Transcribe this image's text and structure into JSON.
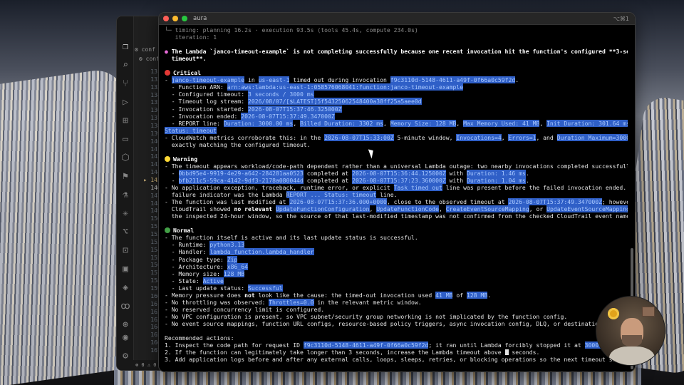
{
  "terminal": {
    "title": "aura",
    "shortcut": "⌥⌘1"
  },
  "editor": {
    "tabs": [
      "conf",
      "conf"
    ],
    "line_numbers": [
      "131",
      "132",
      "133",
      "134",
      "135",
      "136",
      "137",
      "138",
      "139",
      "140",
      "141",
      "142",
      "143",
      "144",
      "145",
      "146",
      "147",
      "148",
      "149",
      "150",
      "151",
      "152",
      "153",
      "154",
      "155",
      "156",
      "157",
      "158",
      "159",
      "160",
      "161",
      "162",
      "163",
      "164",
      "165",
      "166",
      "167"
    ],
    "current_line": "146",
    "marked_line": "145",
    "status": "⊗ 0 ⚠ 0"
  },
  "lines": {
    "l01": [
      {
        "t": "└─ timing: ",
        "c": "dim"
      },
      {
        "t": "planning 16.2s · execution 93.5s (tools 45.4s, compute 234.0s)",
        "c": "dim"
      }
    ],
    "l02": [
      {
        "t": "   iteration: 1",
        "c": "dim"
      }
    ],
    "l03": [
      {
        "t": ""
      }
    ],
    "l04": [
      {
        "t": "● ",
        "c": "pink"
      },
      {
        "t": "The Lambda `janco-timeout-example` is not completing successfully because one recent invocation hit the function's configured **3-second",
        "c": "b"
      }
    ],
    "l05": [
      {
        "t": "  timeout**.",
        "c": "b"
      }
    ],
    "l06": [
      {
        "t": ""
      }
    ],
    "l07": [
      {
        "t": "",
        "circle": "red"
      },
      {
        "t": "Critical",
        "c": "b"
      }
    ],
    "l08": [
      {
        "t": "- "
      },
      {
        "t": "janco-timeout-example",
        "c": "hl"
      },
      {
        "t": " in "
      },
      {
        "t": "us-east-1",
        "c": "hl"
      },
      {
        "t": " timed out during invocation "
      },
      {
        "t": "f9c3110d-5148-4611-a49f-0f66a0c59f2d",
        "c": "hl"
      },
      {
        "t": "."
      }
    ],
    "l09": [
      {
        "t": "  - Function ARN: "
      },
      {
        "t": "arn:aws:lambda:us-east-1:058576068041:function:janco-timeout-example",
        "c": "hl"
      }
    ],
    "l10": [
      {
        "t": "  - Configured timeout: "
      },
      {
        "t": "3 seconds / 3000 ms",
        "c": "hl"
      }
    ],
    "l11": [
      {
        "t": "  - Timeout log stream: "
      },
      {
        "t": "2026/08/07/[$LATEST]5f54325062548400a38ff25a5aee0d",
        "c": "hl"
      }
    ],
    "l12": [
      {
        "t": "  - Invocation started: "
      },
      {
        "t": "2026-08-07T15:37:46.325000Z",
        "c": "hl"
      }
    ],
    "l13": [
      {
        "t": "  - Invocation ended: "
      },
      {
        "t": "2026-08-07T15:37:49.347000Z",
        "c": "hl"
      }
    ],
    "l14": [
      {
        "t": "  - REPORT line: "
      },
      {
        "t": "Duration: 3000.00 ms",
        "c": "hl"
      },
      {
        "t": ", "
      },
      {
        "t": "Billed Duration: 3302 ms",
        "c": "hl"
      },
      {
        "t": ", "
      },
      {
        "t": "Memory Size: 128 MB",
        "c": "hl"
      },
      {
        "t": ", "
      },
      {
        "t": "Max Memory Used: 41 MB",
        "c": "hl"
      },
      {
        "t": ", "
      },
      {
        "t": "Init Duration: 301.64 ms",
        "c": "hl"
      },
      {
        "t": ","
      }
    ],
    "l15": [
      {
        "t": "Status: timeout",
        "c": "hl"
      }
    ],
    "l16": [
      {
        "t": "- CloudWatch metrics corroborate this: in the "
      },
      {
        "t": "2026-08-07T15:33:00Z",
        "c": "hl"
      },
      {
        "t": " 5-minute window, "
      },
      {
        "t": "Invocations=4",
        "c": "hl"
      },
      {
        "t": ", "
      },
      {
        "t": "Errors=1",
        "c": "hl"
      },
      {
        "t": ", and "
      },
      {
        "t": "Duration Maximum=3000.0 ms",
        "c": "hl"
      },
      {
        "t": ","
      }
    ],
    "l17": [
      {
        "t": "  exactly matching the configured timeout."
      }
    ],
    "l18": [
      {
        "t": ""
      }
    ],
    "l19": [
      {
        "t": "",
        "circle": "yel"
      },
      {
        "t": "Warning",
        "c": "b"
      }
    ],
    "l20": [
      {
        "t": "- The timeout appears workload/code-path dependent rather than a universal Lambda outage: two nearby invocations completed successfully."
      }
    ],
    "l21": [
      {
        "t": "  - "
      },
      {
        "t": "0bbd95e4-9919-4e29-a642-284281aa0523",
        "c": "hl"
      },
      {
        "t": " completed at "
      },
      {
        "t": "2026-08-07T15:36:44.125000Z",
        "c": "hl"
      },
      {
        "t": " with "
      },
      {
        "t": "Duration: 1.46 ms",
        "c": "hl"
      },
      {
        "t": "."
      }
    ],
    "l22": [
      {
        "t": "  - "
      },
      {
        "t": "bfb211c5-59ca-4142-9df3-2178a080044d",
        "c": "hl"
      },
      {
        "t": " completed at "
      },
      {
        "t": "2026-08-07T15:37:23.360000Z",
        "c": "hl"
      },
      {
        "t": " with "
      },
      {
        "t": "Duration: 1.04 ms",
        "c": "hl"
      },
      {
        "t": "."
      }
    ],
    "l23": [
      {
        "t": "- No application exception, traceback, runtime error, or explicit "
      },
      {
        "t": "Task timed out",
        "c": "hl"
      },
      {
        "t": " line was present before the failed invocation ended. The only"
      }
    ],
    "l24": [
      {
        "t": "  failure indicator was the Lambda "
      },
      {
        "t": "REPORT ... Status: timeout",
        "c": "hl"
      },
      {
        "t": " line."
      }
    ],
    "l25": [
      {
        "t": "- The function was last modified at "
      },
      {
        "t": "2026-08-07T15:37:36.000+0000",
        "c": "hl"
      },
      {
        "t": ", close to the observed timeout at "
      },
      {
        "t": "2026-08-07T15:37:49.347000Z",
        "c": "hl"
      },
      {
        "t": "; however,"
      }
    ],
    "l26": [
      {
        "t": "  CloudTrail showed "
      },
      {
        "t": "no relevant",
        "c": "b"
      },
      {
        "t": " "
      },
      {
        "t": "UpdateFunctionConfiguration",
        "c": "hl"
      },
      {
        "t": ", "
      },
      {
        "t": "UpdateFunctionCode",
        "c": "hl"
      },
      {
        "t": ", "
      },
      {
        "t": "CreateEventSourceMapping",
        "c": "hl"
      },
      {
        "t": ", or "
      },
      {
        "t": "UpdateEventSourceMapping",
        "c": "hl"
      },
      {
        "t": " events in"
      }
    ],
    "l27": [
      {
        "t": "  the inspected 24-hour window, so the source of that last-modified timestamp was not confirmed from the checked CloudTrail event names."
      }
    ],
    "l28": [
      {
        "t": ""
      }
    ],
    "l29": [
      {
        "t": "",
        "circle": "grn"
      },
      {
        "t": "Normal",
        "c": "b"
      }
    ],
    "l30": [
      {
        "t": "- The function itself is active and its last update status is successful."
      }
    ],
    "l31": [
      {
        "t": "  - Runtime: "
      },
      {
        "t": "python3.13",
        "c": "hl"
      }
    ],
    "l32": [
      {
        "t": "  - Handler: "
      },
      {
        "t": "lambda_function.lambda_handler",
        "c": "hl"
      }
    ],
    "l33": [
      {
        "t": "  - Package type: "
      },
      {
        "t": "Zip",
        "c": "hl"
      }
    ],
    "l34": [
      {
        "t": "  - Architecture: "
      },
      {
        "t": "x86_64",
        "c": "hl"
      }
    ],
    "l35": [
      {
        "t": "  - Memory size: "
      },
      {
        "t": "128 MB",
        "c": "hl"
      }
    ],
    "l36": [
      {
        "t": "  - State: "
      },
      {
        "t": "Active",
        "c": "hl"
      }
    ],
    "l37": [
      {
        "t": "  - Last update status: "
      },
      {
        "t": "Successful",
        "c": "hl"
      }
    ],
    "l38": [
      {
        "t": "- Memory pressure does "
      },
      {
        "t": "not",
        "c": "b"
      },
      {
        "t": " look like the cause: the timed-out invocation used "
      },
      {
        "t": "41 MB",
        "c": "hl"
      },
      {
        "t": " of "
      },
      {
        "t": "128 MB",
        "c": "hl"
      },
      {
        "t": "."
      }
    ],
    "l39": [
      {
        "t": "- No throttling was observed: "
      },
      {
        "t": "Throttles=0.0",
        "c": "hl"
      },
      {
        "t": " in the relevant metric window."
      }
    ],
    "l40": [
      {
        "t": "- No reserved concurrency limit is configured."
      }
    ],
    "l41": [
      {
        "t": "- No VPC configuration is present, so VPC subnet/security group networking is not implicated by the function config."
      }
    ],
    "l42": [
      {
        "t": "- No event source mappings, function URL configs, resource-based policy triggers, async invocation config, DLQ, or destinations were found."
      }
    ],
    "l43": [
      {
        "t": ""
      }
    ],
    "l44": [
      {
        "t": "Recommended actions:"
      }
    ],
    "l45": [
      {
        "t": "1. Inspect the code path for request ID "
      },
      {
        "t": "f9c3110d-5148-4611-a49f-0f66a0c59f2d",
        "c": "hl"
      },
      {
        "t": "; it ran until Lambda forcibly stopped it at "
      },
      {
        "t": "3000 ms",
        "c": "hl"
      },
      {
        "t": "."
      }
    ],
    "l46": [
      {
        "t": "2. If the function can legitimately take longer than 3 seconds, increase the Lambda timeout above "
      },
      {
        "t": "",
        "cursor": true
      },
      {
        "t": " seconds."
      }
    ],
    "l47": [
      {
        "t": "3. Add application logs before and after any external calls, loops, sleeps, retries, or blocking operations so the next timeout shows where"
      }
    ]
  },
  "colors": {
    "highlight": "#2f5fc7",
    "critical": "#e53935",
    "warning": "#fdd835",
    "normal": "#43a047",
    "bullet": "#e86bd8"
  }
}
